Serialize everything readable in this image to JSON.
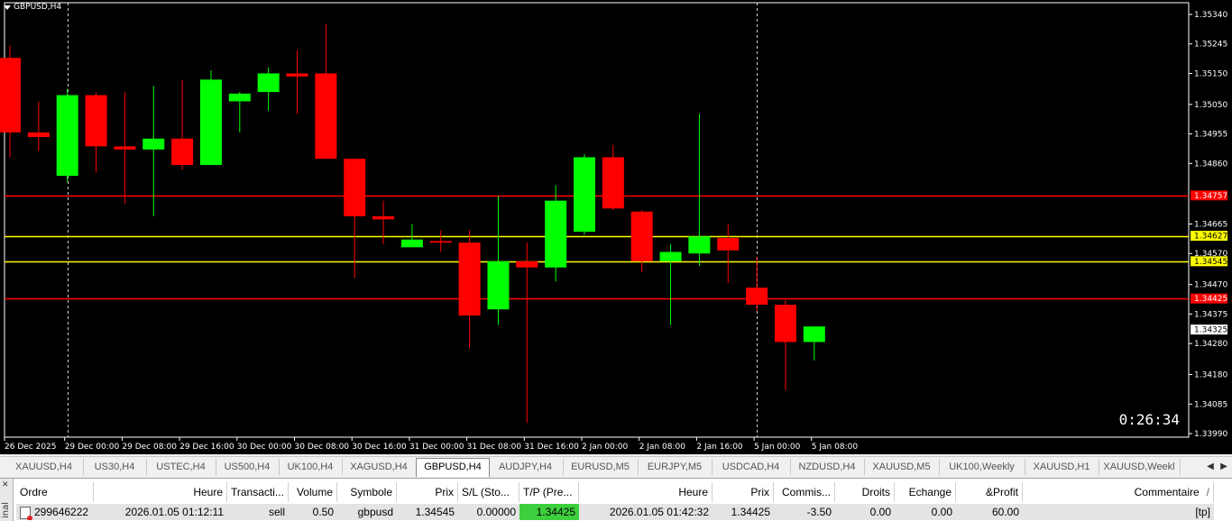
{
  "chart": {
    "title": "GBPUSD,H4",
    "timer": "0:26:34",
    "colors": {
      "bull": "#00ff00",
      "bear": "#ff0000",
      "background": "#000000",
      "axis": "#ffffff",
      "red_line": "#ff0000",
      "yellow_line": "#ffff00"
    }
  },
  "chart_data": {
    "type": "candlestick",
    "symbol": "GBPUSD",
    "timeframe": "H4",
    "ylim": [
      1.3399,
      1.3534
    ],
    "price_ticks": [
      "1.35340",
      "1.35245",
      "1.35150",
      "1.35050",
      "1.34955",
      "1.34860",
      "1.34665",
      "1.34570",
      "1.34470",
      "1.34375",
      "1.34280",
      "1.34180",
      "1.34085",
      "1.33990"
    ],
    "time_ticks": [
      "26 Dec 2025",
      "29 Dec 00:00",
      "29 Dec 08:00",
      "29 Dec 16:00",
      "30 Dec 00:00",
      "30 Dec 08:00",
      "30 Dec 16:00",
      "31 Dec 00:00",
      "31 Dec 08:00",
      "31 Dec 16:00",
      "2 Jan 00:00",
      "2 Jan 08:00",
      "2 Jan 16:00",
      "5 Jan 00:00",
      "5 Jan 08:00"
    ],
    "candles": [
      {
        "o": 1.352,
        "h": 1.3524,
        "l": 1.3488,
        "c": 1.3496
      },
      {
        "o": 1.3496,
        "h": 1.3506,
        "l": 1.349,
        "c": 1.34945
      },
      {
        "o": 1.3482,
        "h": 1.351,
        "l": 1.348,
        "c": 1.3508
      },
      {
        "o": 1.3508,
        "h": 1.3509,
        "l": 1.3483,
        "c": 1.34915
      },
      {
        "o": 1.34915,
        "h": 1.3509,
        "l": 1.3473,
        "c": 1.34905
      },
      {
        "o": 1.34905,
        "h": 1.3511,
        "l": 1.3469,
        "c": 1.3494
      },
      {
        "o": 1.3494,
        "h": 1.3513,
        "l": 1.3484,
        "c": 1.34855
      },
      {
        "o": 1.34855,
        "h": 1.3516,
        "l": 1.34855,
        "c": 1.3513
      },
      {
        "o": 1.3506,
        "h": 1.3509,
        "l": 1.3496,
        "c": 1.35085
      },
      {
        "o": 1.3509,
        "h": 1.3517,
        "l": 1.3503,
        "c": 1.3515
      },
      {
        "o": 1.3515,
        "h": 1.35225,
        "l": 1.3502,
        "c": 1.3514
      },
      {
        "o": 1.3515,
        "h": 1.3531,
        "l": 1.3488,
        "c": 1.34875
      },
      {
        "o": 1.34875,
        "h": 1.34875,
        "l": 1.3449,
        "c": 1.3469
      },
      {
        "o": 1.3469,
        "h": 1.3474,
        "l": 1.346,
        "c": 1.3468
      },
      {
        "o": 1.3459,
        "h": 1.34665,
        "l": 1.3459,
        "c": 1.34615
      },
      {
        "o": 1.3461,
        "h": 1.34645,
        "l": 1.34575,
        "c": 1.34605
      },
      {
        "o": 1.34605,
        "h": 1.34645,
        "l": 1.34265,
        "c": 1.3437
      },
      {
        "o": 1.3439,
        "h": 1.34755,
        "l": 1.3434,
        "c": 1.34545
      },
      {
        "o": 1.34545,
        "h": 1.34605,
        "l": 1.34025,
        "c": 1.34525
      },
      {
        "o": 1.34525,
        "h": 1.3479,
        "l": 1.3448,
        "c": 1.3474
      },
      {
        "o": 1.3464,
        "h": 1.3489,
        "l": 1.3463,
        "c": 1.3488
      },
      {
        "o": 1.3488,
        "h": 1.3492,
        "l": 1.3471,
        "c": 1.34715
      },
      {
        "o": 1.34705,
        "h": 1.3471,
        "l": 1.3451,
        "c": 1.34545
      },
      {
        "o": 1.34545,
        "h": 1.346,
        "l": 1.3434,
        "c": 1.34575
      },
      {
        "o": 1.3457,
        "h": 1.3502,
        "l": 1.3453,
        "c": 1.34625
      },
      {
        "o": 1.3462,
        "h": 1.34665,
        "l": 1.34475,
        "c": 1.3458
      },
      {
        "o": 1.3446,
        "h": 1.3456,
        "l": 1.34385,
        "c": 1.34405
      },
      {
        "o": 1.34405,
        "h": 1.3442,
        "l": 1.3413,
        "c": 1.34285
      },
      {
        "o": 1.34285,
        "h": 1.34335,
        "l": 1.34225,
        "c": 1.34335
      }
    ],
    "horizontal_lines": [
      {
        "price": 1.34757,
        "label": "1.34757",
        "color": "#ff0000"
      },
      {
        "price": 1.34627,
        "label": "1.34627",
        "color": "#ffff00"
      },
      {
        "price": 1.34545,
        "label": "1.34545",
        "color": "#ffff00"
      },
      {
        "price": 1.34425,
        "label": "1.34425",
        "color": "#ff0000"
      }
    ],
    "current_price": "1.34325",
    "period_separators": [
      "29 Dec 00:00",
      "5 Jan 00:00"
    ]
  },
  "tabs": [
    {
      "label": "XAUUSD,H4",
      "active": false
    },
    {
      "label": "US30,H4",
      "active": false
    },
    {
      "label": "USTEC,H4",
      "active": false
    },
    {
      "label": "US500,H4",
      "active": false
    },
    {
      "label": "UK100,H4",
      "active": false
    },
    {
      "label": "XAGUSD,H4",
      "active": false
    },
    {
      "label": "GBPUSD,H4",
      "active": true
    },
    {
      "label": "AUDJPY,H4",
      "active": false
    },
    {
      "label": "EURUSD,M5",
      "active": false
    },
    {
      "label": "EURJPY,M5",
      "active": false
    },
    {
      "label": "USDCAD,H4",
      "active": false
    },
    {
      "label": "NZDUSD,H4",
      "active": false
    },
    {
      "label": "XAUUSD,M5",
      "active": false
    },
    {
      "label": "UK100,Weekly",
      "active": false
    },
    {
      "label": "XAUUSD,H1",
      "active": false
    },
    {
      "label": "XAUUSD,Weekl",
      "active": false
    }
  ],
  "tab_nav": {
    "left": "◀",
    "right": "▶"
  },
  "terminal": {
    "side_label": "inal",
    "close": "✕",
    "headers": [
      "Ordre",
      "Heure",
      "Transacti...",
      "Volume",
      "Symbole",
      "Prix",
      "S/L (Sto...",
      "T/P (Pre...",
      "Heure",
      "Prix",
      "Commis...",
      "Droits",
      "Echange",
      "&Profit",
      "Commentaire"
    ],
    "sort_indicator": "/",
    "row": [
      "299646222",
      "2026.01.05 01:12:11",
      "sell",
      "0.50",
      "gbpusd",
      "1.34545",
      "0.00000",
      "1.34425",
      "2026.01.05 01:42:32",
      "1.34425",
      "-3.50",
      "0.00",
      "0.00",
      "60.00",
      "[tp]"
    ]
  }
}
